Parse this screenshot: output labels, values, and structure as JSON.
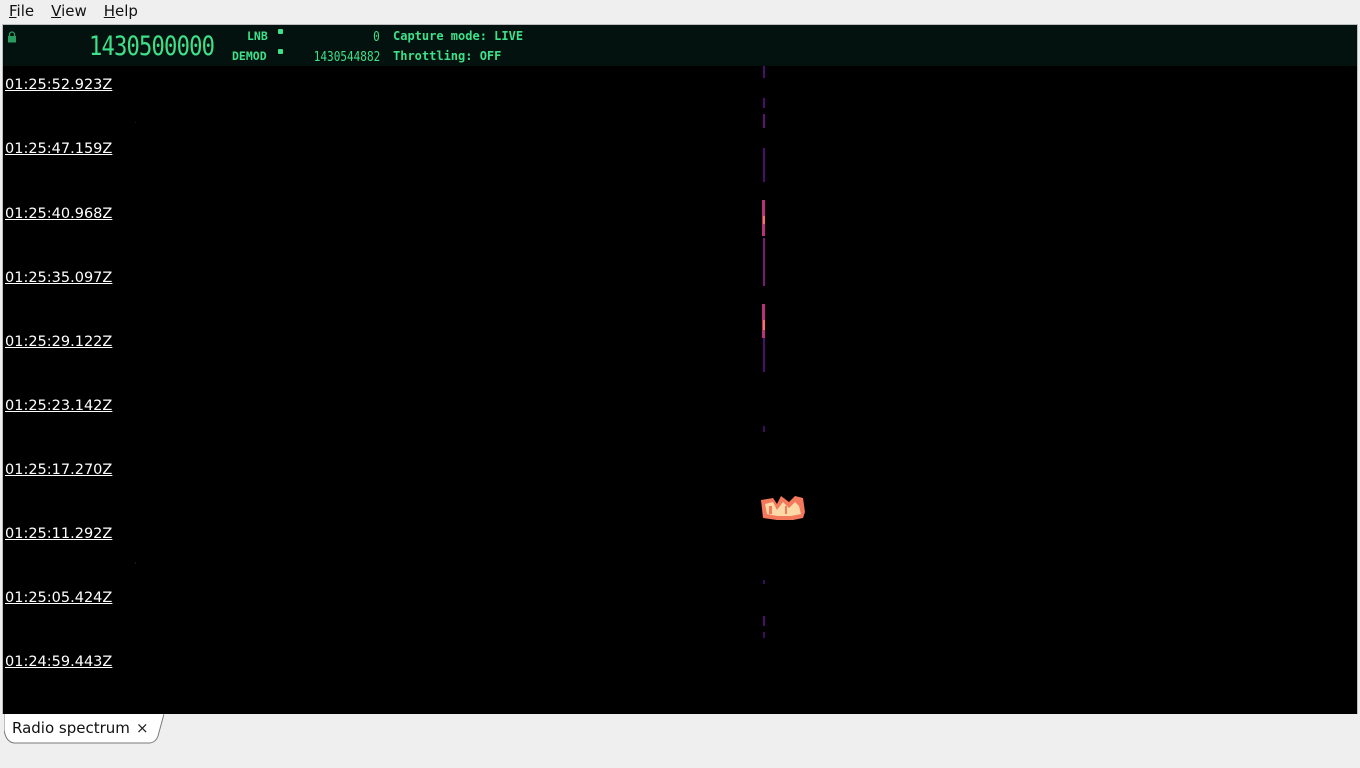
{
  "menu": {
    "items": [
      {
        "mnemonic": "F",
        "rest": "ile"
      },
      {
        "mnemonic": "V",
        "rest": "iew"
      },
      {
        "mnemonic": "H",
        "rest": "elp"
      }
    ]
  },
  "header": {
    "main_frequency": "1430500000",
    "lnb_label": "LNB",
    "demod_label": "DEMOD",
    "lnb_value": "0",
    "demod_value": "1430544882",
    "capture_mode": "Capture mode: LIVE",
    "throttling": "Throttling: OFF",
    "accent_color": "#3ee08a",
    "header_bg": "#03120e"
  },
  "waterfall": {
    "timestamps": [
      "01:25:52.923Z",
      "01:25:47.159Z",
      "01:25:40.968Z",
      "01:25:35.097Z",
      "01:25:29.122Z",
      "01:25:23.142Z",
      "01:25:17.270Z",
      "01:25:11.292Z",
      "01:25:05.424Z",
      "01:24:59.443Z"
    ],
    "colormap": [
      "#000000",
      "#4a0f6e",
      "#b8327a",
      "#f4785c",
      "#fcd9a6"
    ]
  },
  "tabs": [
    {
      "label": "Radio spectrum",
      "close": "×"
    }
  ]
}
